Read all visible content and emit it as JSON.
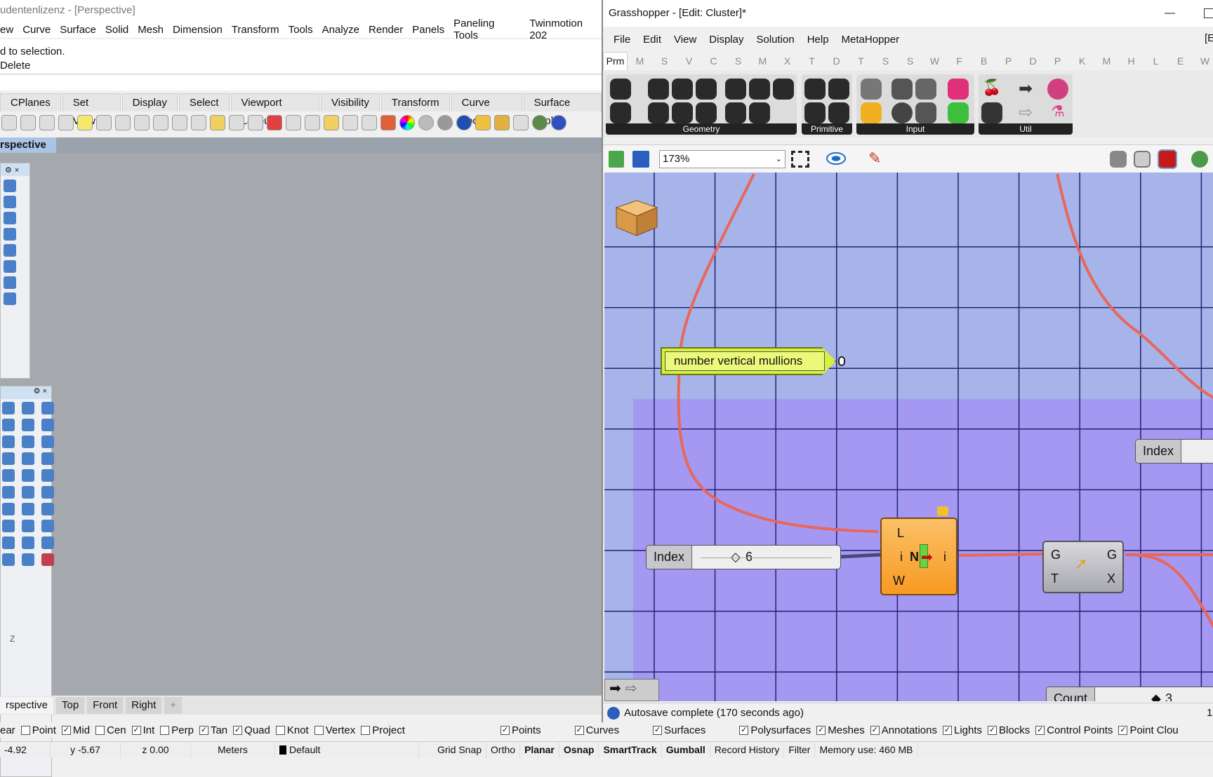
{
  "rhino": {
    "title": "udentenlizenz - [Perspective]",
    "menu": [
      "ew",
      "Curve",
      "Surface",
      "Solid",
      "Mesh",
      "Dimension",
      "Transform",
      "Tools",
      "Analyze",
      "Render",
      "Panels",
      "Paneling Tools",
      "Twinmotion 202"
    ],
    "command_history": [
      "d to selection.",
      "Delete"
    ],
    "toolbar_tabs": [
      "CPlanes",
      "Set View",
      "Display",
      "Select",
      "Viewport Layout",
      "Visibility",
      "Transform",
      "Curve Tools",
      "Surface Tools"
    ],
    "viewport_title": "rspective",
    "viewport_tabs": [
      "rspective",
      "Top",
      "Front",
      "Right",
      "+"
    ],
    "axis_label": "Z"
  },
  "osnap": [
    {
      "label": "ear",
      "checked": null
    },
    {
      "label": "Point",
      "checked": false
    },
    {
      "label": "Mid",
      "checked": true
    },
    {
      "label": "Cen",
      "checked": false
    },
    {
      "label": "Int",
      "checked": true
    },
    {
      "label": "Perp",
      "checked": false
    },
    {
      "label": "Tan",
      "checked": true
    },
    {
      "label": "Quad",
      "checked": true
    },
    {
      "label": "Knot",
      "checked": false
    },
    {
      "label": "Vertex",
      "checked": false
    },
    {
      "label": "Project",
      "checked": false
    }
  ],
  "filters": [
    {
      "label": "Points",
      "checked": true
    },
    {
      "label": "Curves",
      "checked": true
    },
    {
      "label": "Surfaces",
      "checked": true
    },
    {
      "label": "Polysurfaces",
      "checked": true
    },
    {
      "label": "Meshes",
      "checked": true
    },
    {
      "label": "Annotations",
      "checked": true
    },
    {
      "label": "Lights",
      "checked": true
    },
    {
      "label": "Blocks",
      "checked": true
    },
    {
      "label": "Control Points",
      "checked": true
    },
    {
      "label": "Point Clou",
      "checked": true
    }
  ],
  "status": {
    "x": "-4.92",
    "y": "y -5.67",
    "z": "z 0.00",
    "units": "Meters",
    "layer": "Default",
    "items": [
      "Grid Snap",
      "Ortho",
      "Planar",
      "Osnap",
      "SmartTrack",
      "Gumball",
      "Record History",
      "Filter"
    ],
    "bold_items": [
      "Planar",
      "Osnap",
      "SmartTrack",
      "Gumball"
    ],
    "memory": "Memory use: 460 MB"
  },
  "grasshopper": {
    "title": "Grasshopper - [Edit: Cluster]*",
    "menu": [
      "File",
      "Edit",
      "View",
      "Display",
      "Solution",
      "Help",
      "MetaHopper"
    ],
    "menu_right": "[E",
    "tabs": [
      "Prm",
      "M",
      "S",
      "V",
      "C",
      "S",
      "M",
      "X",
      "T",
      "D",
      "T",
      "S",
      "S",
      "W",
      "F",
      "B",
      "P",
      "D",
      "P",
      "K",
      "M",
      "H",
      "L",
      "E",
      "W"
    ],
    "ribbon_groups": [
      "Geometry",
      "Primitive",
      "Input",
      "Util"
    ],
    "zoom": "173%",
    "status": "Autosave complete (170 seconds ago)",
    "status_right": "1",
    "canvas": {
      "panel_text": "number vertical mullions",
      "slider_index": {
        "label": "Index",
        "value": "6"
      },
      "slider_index_right": {
        "label": "Index"
      },
      "slider_count": {
        "label": "Count",
        "value": "3"
      },
      "component_orange": {
        "inputs": [
          "L",
          "i",
          "W"
        ],
        "outputs": [
          "i"
        ],
        "icon_text": "N"
      },
      "component_gray": {
        "inputs": [
          "G",
          "T"
        ],
        "outputs": [
          "G",
          "X"
        ]
      }
    },
    "colors": {
      "canvas": "#a6b4ea",
      "group": "#a598f2",
      "wire": "#e8675a",
      "component": "#f7a02c",
      "panel": "#d8ef3c"
    }
  }
}
